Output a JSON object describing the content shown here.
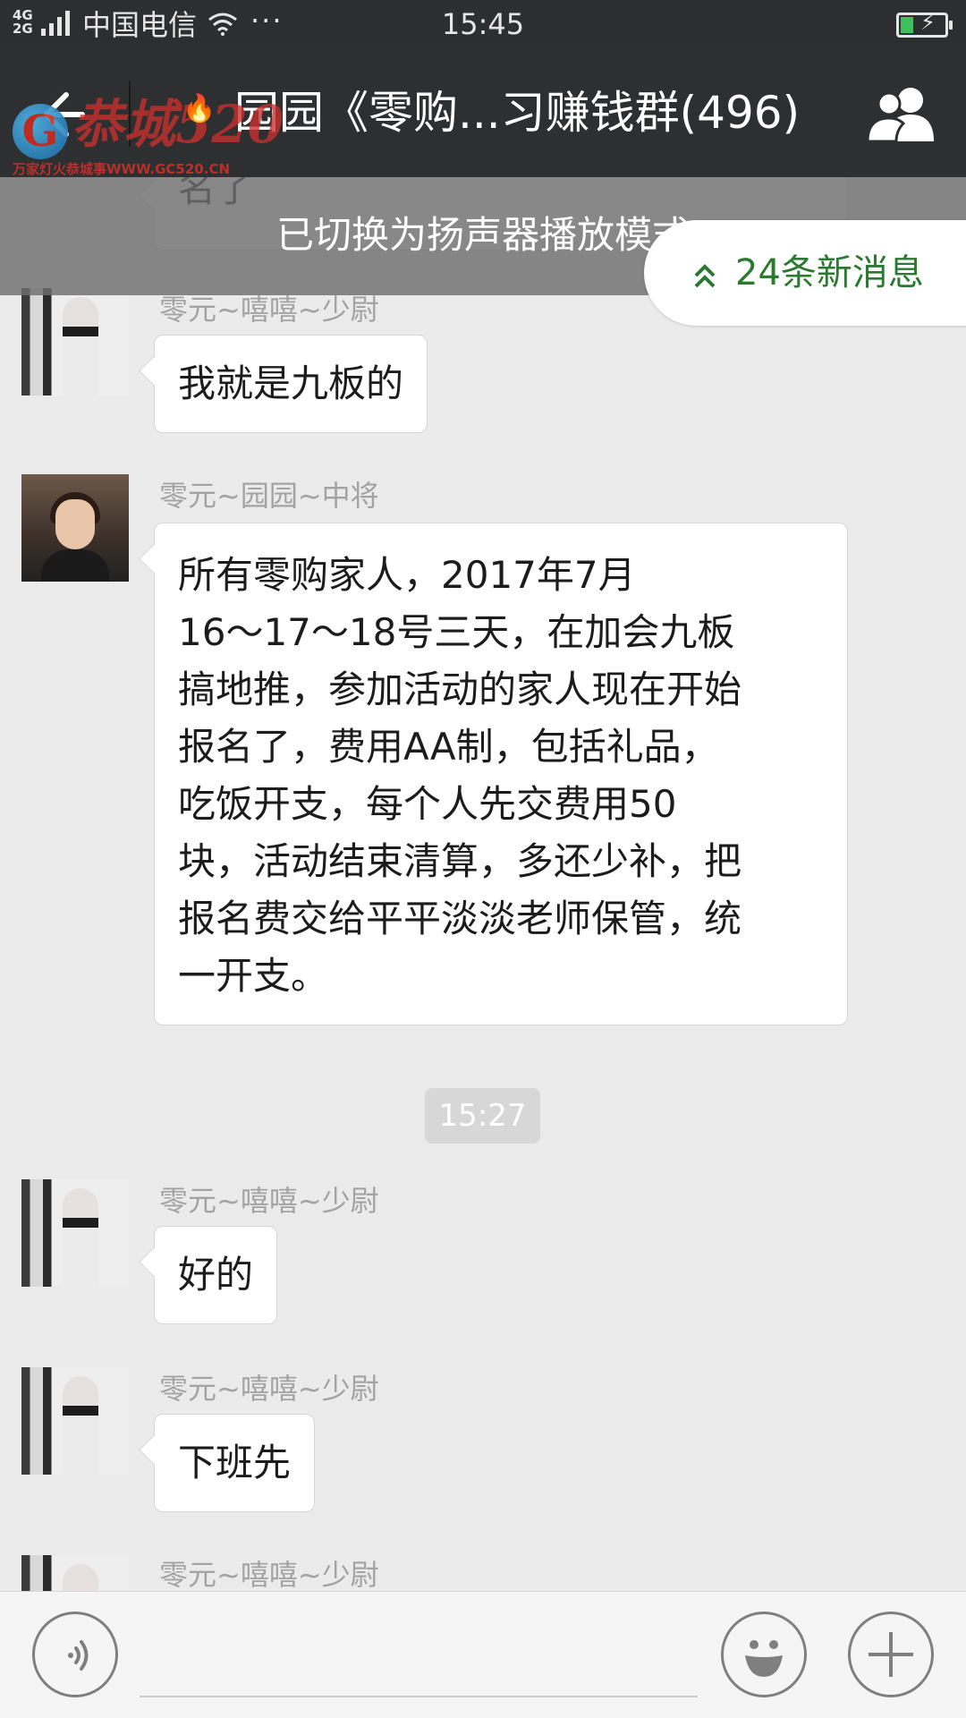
{
  "status_bar": {
    "network": "4G 2G",
    "carrier": "中国电信",
    "more": "···",
    "time": "15:45",
    "battery_charge_fraction": 0.3,
    "colors": {
      "battery_fill": "#3ec15c"
    }
  },
  "title_bar": {
    "title": "园园《零购...习赚钱群(496)",
    "back_icon": "back-arrow-icon",
    "group_icon": "group-members-icon"
  },
  "watermark": {
    "site_text": "万家灯火恭城事WWW.GC520.CN"
  },
  "toast": {
    "text": "已切换为扬声器播放模式"
  },
  "new_messages": {
    "label": "24条新消息",
    "icon": "double-chevron-up-icon",
    "color": "#2a7a2f"
  },
  "messages": [
    {
      "sender": "",
      "text": "名了"
    },
    {
      "sender": "零元~嘻嘻~少尉",
      "text": "我就是九板的"
    },
    {
      "sender": "零元~园园~中将",
      "lines": [
        "所有零购家人，2017年7月",
        "16～17～18号三天，在加会九板",
        "搞地推，参加活动的家人现在开始",
        "报名了，费用AA制，包括礼品，",
        "吃饭开支，每个人先交费用50",
        "块，活动结束清算，多还少补，把",
        "报名费交给平平淡淡老师保管，统",
        "一开支。"
      ]
    },
    {
      "sender": "零元~嘻嘻~少尉",
      "text": "好的"
    },
    {
      "sender": "零元~嘻嘻~少尉",
      "text": "下班先"
    },
    {
      "sender": "零元~嘻嘻~少尉",
      "text": ""
    }
  ],
  "timestamp": "15:27",
  "bottom_bar": {
    "voice_icon": "voice-input-icon",
    "emoji_icon": "emoji-icon",
    "plus_icon": "plus-icon"
  }
}
